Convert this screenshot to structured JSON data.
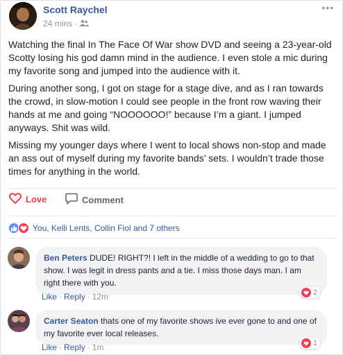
{
  "post": {
    "author": "Scott Raychel",
    "time": "24 mins",
    "separator": "·",
    "audience_icon": "friends-icon",
    "menu_icon": "more-icon",
    "menu_label": "•••",
    "paragraphs": [
      "Watching the final In The Face Of War show DVD and seeing a 23-year-old Scotty losing his god damn mind in the audience. I even stole a mic during my favorite song and jumped into the audience with it.",
      "During another song, I got on stage for a stage dive, and as I ran towards the crowd, in slow-motion I could see people in the front row waving their hands at me and going “NOOOOOO!” because I’m a giant. I jumped anyways. Shit was wild.",
      "Missing my younger days where I went to local shows non-stop and made an ass out of myself during my favorite bands’ sets. I wouldn’t trade those times for anything in the world."
    ]
  },
  "actions": {
    "love_label": "Love",
    "comment_label": "Comment"
  },
  "reactions": {
    "summary": "You, Kelli Lents, Collin Fiol and 7 others"
  },
  "comments": [
    {
      "author": "Ben Peters",
      "text": "DUDE! RIGHT?! I left in the middle of a wedding to go to that show. I was legit in dress pants and a tie. I miss those days man. I am right there with you.",
      "like_label": "Like",
      "reply_label": "Reply",
      "time": "12m",
      "reaction_count": "2"
    },
    {
      "author": "Carter Seaton",
      "text": "thats one of my favorite shows ive ever gone to and one of my favorite ever local releases.",
      "like_label": "Like",
      "reply_label": "Reply",
      "time": "1m",
      "reaction_count": "1"
    }
  ],
  "colors": {
    "link_blue": "#365899",
    "love_red": "#f33e58",
    "like_blue": "#5890ff",
    "meta_gray": "#90949c",
    "bubble_bg": "#f2f3f5"
  }
}
